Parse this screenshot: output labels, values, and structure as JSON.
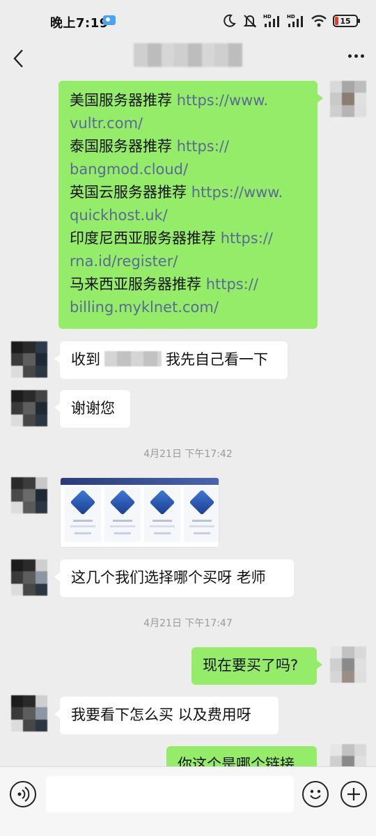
{
  "status_bar": {
    "time": "晚上7:19",
    "battery": "15"
  },
  "chat": {
    "messages": [
      {
        "lines": [
          {
            "text": "美国服务器推荐 ",
            "link": "https://www."
          },
          {
            "text": "",
            "link": "vultr.com/"
          },
          {
            "text": "泰国服务器推荐 ",
            "link": "https://"
          },
          {
            "text": "",
            "link": "bangmod.cloud/"
          },
          {
            "text": "英国云服务器推荐 ",
            "link": "https://www."
          },
          {
            "text": "",
            "link": "quickhost.uk/"
          },
          {
            "text": "印度尼西亚服务器推荐 ",
            "link": "https://"
          },
          {
            "text": "",
            "link": "rna.id/register/"
          },
          {
            "text": "马来西亚服务器推荐 ",
            "link": "https://"
          },
          {
            "text": "",
            "link": "billing.myklnet.com/"
          }
        ]
      },
      {
        "prefix": "收到",
        "suffix": "我先自己看一下"
      },
      {
        "text": "谢谢您"
      },
      {
        "timestamp": "4月21日 下午17:42"
      },
      {
        "text": "这几个我们选择哪个买呀 老师"
      },
      {
        "timestamp": "4月21日 下午17:47"
      },
      {
        "text": "现在要买了吗?"
      },
      {
        "text": "我要看下怎么买 以及费用呀"
      },
      {
        "text": "你这个是哪个链接"
      }
    ]
  },
  "icons": {
    "back": "back-arrow-icon",
    "more": "more-icon",
    "voice": "voice-icon",
    "emoji": "emoji-icon",
    "plus": "plus-icon"
  },
  "colors": {
    "background": "#ededed",
    "outgoing_bubble": "#95ec69",
    "incoming_bubble": "#ffffff",
    "link": "#576b95",
    "timestamp": "#999999"
  }
}
